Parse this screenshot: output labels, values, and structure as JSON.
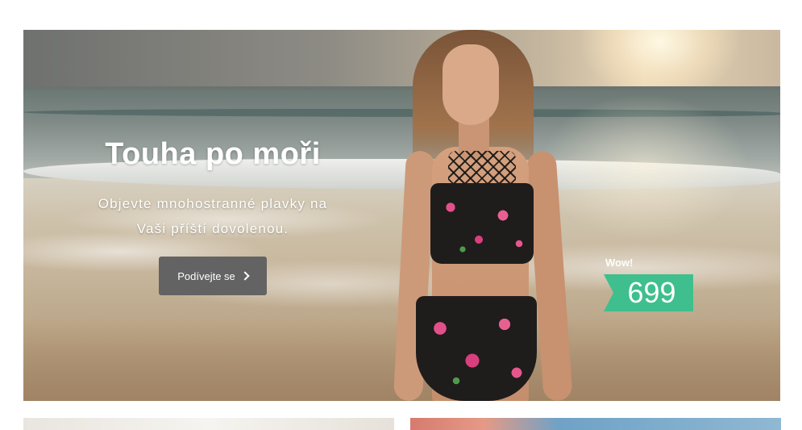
{
  "hero": {
    "title": "Touha po moři",
    "subtitle": "Objevte mnohostranné plavky na Vaši příští dovolenou.",
    "cta_label": "Podívejte se",
    "cta_icon": "chevron-right-icon",
    "badge_label": "Wow!",
    "price": "699",
    "price_color": "#3fbf8d",
    "cta_color": "#636363"
  }
}
